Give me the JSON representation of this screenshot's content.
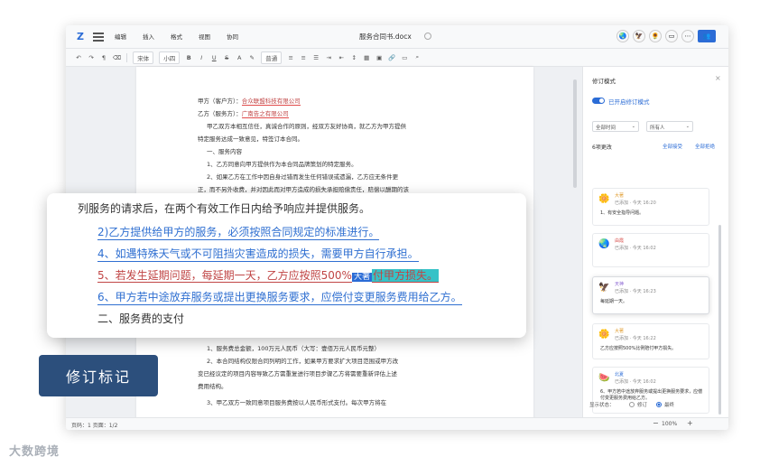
{
  "titlebar": {
    "logo": "Z",
    "menus": [
      "编辑",
      "插入",
      "格式",
      "视图",
      "协同"
    ],
    "doc_title": "服务合同书.docx",
    "share": "共享"
  },
  "toolbar": {
    "font": "宋体",
    "size": "小四",
    "bold": "B",
    "italic": "I",
    "underline": "U",
    "strike": "S",
    "color": "A",
    "style": "普通"
  },
  "document": {
    "lines": [
      "甲方（客户方）：",
      "乙方（服务方）：",
      "甲乙双方本相互信任，真诚合作的原则，经双方友好协商，就乙方为甲方提供",
      "特定服务达成一致意见，特签订本合同。",
      "一、服务内容",
      "1、乙方同意向甲方提供作为本合同品牌策划的特定服务。",
      "2、如果乙方在工作中因自身过错而发生任何错误或遗漏，乙方应无条件更",
      "正，而不另外收费，并对因此而对甲方造成的损失承担赔偿责任，赔偿以酬期的该",
      "1、服务费总金额，100万元人民币（大写：壹佰万元人民币元整）",
      "2、本合同结构仅限合同列明的工作，如果甲方要求扩大项目范围或甲方改",
      "变已经议定的项目内容导致乙方需重复进行项目步骤乙方将需要重新评估上述",
      "费用结构。",
      "3、甲乙双方一致同意项目服务费按以人民币形式支付。每次甲方将在"
    ],
    "party_a_name": "合众联盟科技有限公司",
    "party_b_name": "广南告之有限公司"
  },
  "callout": {
    "line1": "列服务的请求后，在两个有效工作日内给予响应并提供服务。",
    "line2": "2)乙方提供给甲方的服务，必须按照合同规定的标准进行。",
    "line3": "4、如遇特殊天气或不可阻挡灾害造成的损失，需要甲方自行承担。",
    "line4a": "5、若发生延期问题，每延期一天，乙方应按照500%",
    "line4_tag": "大著",
    "line4b": "付甲方损失。",
    "line5": "6、甲方若中途放弃服务或提出更换服务要求，应偿付变更服务费用给乙方。",
    "line6": "二、服务费的支付"
  },
  "label": "修订标记",
  "statusbar": {
    "page": "页码：1  页面：1/2",
    "zoom": "100%"
  },
  "panel": {
    "title": "修订模式",
    "toggle_label": "已开启修订模式",
    "filter_time": "全部时间",
    "filter_people": "所有人",
    "count": "6项更改",
    "accept_all": "全部接受",
    "reject_all": "全部拒绝",
    "revisions": [
      {
        "name": "大著",
        "meta": "已添加 · 今天 16:20",
        "text": "1、有安全指导问题。"
      },
      {
        "name": "由霞",
        "meta": "已添加 · 今天 16:02",
        "text": ""
      },
      {
        "name": "天神",
        "meta": "已添加 · 今天 16:23",
        "text": "每延期一天。"
      },
      {
        "name": "大著",
        "meta": "已添加 · 今天 16:22",
        "text": "乙方应按照500%比例赔付甲方损失。"
      },
      {
        "name": "北夏",
        "meta": "已添加 · 今天 16:02",
        "text": "6、甲方若中途放弃服务或提出更换服务要求，应偿付变更服务费用给乙方。"
      }
    ],
    "show_state": "显示状态：",
    "opt_revise": "修订",
    "opt_final": "最终"
  },
  "watermark": "大数跨境"
}
